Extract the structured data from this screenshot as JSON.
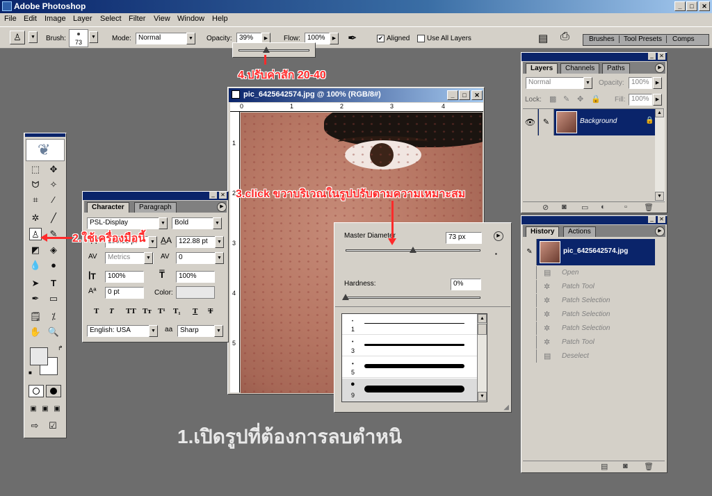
{
  "app": {
    "title": "Adobe Photoshop",
    "win_min": "_",
    "win_max": "□",
    "win_close": "✕"
  },
  "menu": [
    "File",
    "Edit",
    "Image",
    "Layer",
    "Select",
    "Filter",
    "View",
    "Window",
    "Help"
  ],
  "options": {
    "brush_label": "Brush:",
    "brush_size": "73",
    "mode_label": "Mode:",
    "mode_value": "Normal",
    "opacity_label": "Opacity:",
    "opacity_value": "39%",
    "flow_label": "Flow:",
    "flow_value": "100%",
    "aligned_label": "Aligned",
    "aligned_checked": true,
    "use_all_layers_label": "Use All Layers",
    "use_all_layers_checked": false,
    "well_tabs": [
      "Brushes",
      "Tool Presets",
      "Comps"
    ],
    "opacity_slider_level": 0.39
  },
  "annotations": {
    "step1": "1.เปิดรูปที่ต้องการลบตำหนิ",
    "step2": "2.ใช้เครื่องมือนี้",
    "step3": "3.click ขวาบริเวณในรูปปรับตามความเหมาะสม",
    "step4": "4.ปรับค่าสัก 20-40"
  },
  "document": {
    "title": "pic_6425642574.jpg @ 100% (RGB/8#)",
    "ruler_top": [
      "0",
      "1",
      "2",
      "3",
      "4"
    ],
    "ruler_left": [
      "1",
      "2",
      "3",
      "4",
      "5"
    ]
  },
  "character": {
    "tabs": [
      "Character",
      "Paragraph"
    ],
    "font_family": "PSL-Display",
    "font_style": "Bold",
    "font_size": "159.58 pt",
    "leading": "122.88 pt",
    "kerning": "Metrics",
    "tracking": "0",
    "vscale": "100%",
    "hscale": "100%",
    "baseline": "0 pt",
    "color_label": "Color:",
    "style_buttons": [
      "T",
      "T",
      "TT",
      "Tт",
      "T¹",
      "T₁",
      "T",
      "T"
    ],
    "language": "English: USA",
    "aa_label": "a",
    "antialias": "Sharp"
  },
  "brush_picker": {
    "master_label": "Master Diameter",
    "master_value": "73 px",
    "master_level": 0.5,
    "hardness_label": "Hardness:",
    "hardness_value": "0%",
    "hardness_level": 0,
    "presets": [
      "1",
      "3",
      "5",
      "9"
    ]
  },
  "layers_panel": {
    "tabs": [
      "Layers",
      "Channels",
      "Paths"
    ],
    "mode": "Normal",
    "opacity_label": "Opacity:",
    "opacity_value": "100%",
    "lock_label": "Lock:",
    "fill_label": "Fill:",
    "fill_value": "100%",
    "layer_name": "Background"
  },
  "history_panel": {
    "tabs": [
      "History",
      "Actions"
    ],
    "snapshot_name": "pic_6425642574.jpg",
    "steps": [
      "Open",
      "Patch Tool",
      "Patch Selection",
      "Patch Selection",
      "Patch Selection",
      "Patch Tool",
      "Deselect"
    ]
  }
}
